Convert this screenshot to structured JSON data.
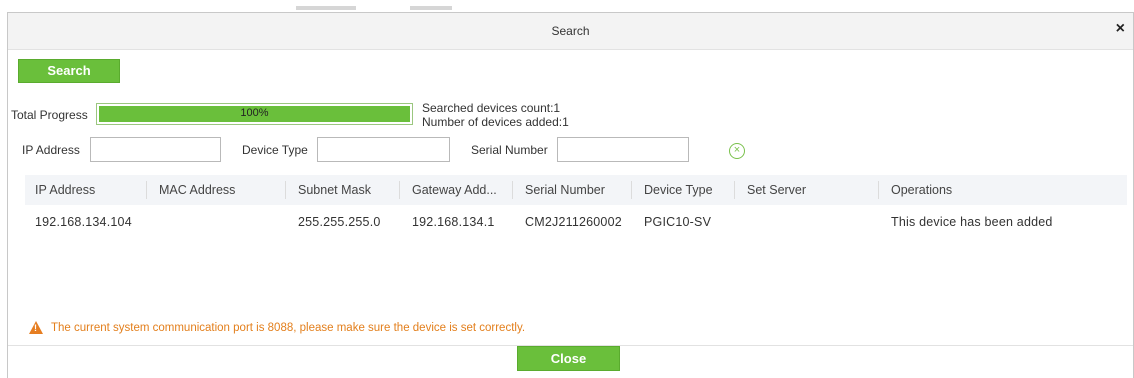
{
  "dialog": {
    "title": "Search",
    "close_glyph": "×"
  },
  "toolbar": {
    "search_label": "Search"
  },
  "progress": {
    "label": "Total Progress",
    "percent": 100,
    "percent_text": "100%",
    "searched_count_text": "Searched devices count:1",
    "added_count_text": "Number of devices added:1"
  },
  "filters": {
    "ip_label": "IP Address",
    "ip_value": "",
    "device_type_label": "Device Type",
    "device_type_value": "",
    "serial_label": "Serial Number",
    "serial_value": "",
    "clear_icon": "clear-circle-icon"
  },
  "table": {
    "columns": [
      "IP Address",
      "MAC Address",
      "Subnet Mask",
      "Gateway Add...",
      "Serial Number",
      "Device Type",
      "Set Server",
      "Operations"
    ],
    "rows": [
      {
        "ip": "192.168.134.104",
        "mac": "",
        "subnet": "255.255.255.0",
        "gateway": "192.168.134.1",
        "serial": "CM2J211260002",
        "device_type": "PGIC10-SV",
        "set_server": "",
        "operations": "This device has been added"
      }
    ]
  },
  "warning": {
    "icon": "warning-triangle-icon",
    "text": "The current system communication port is 8088, please make sure the device is set correctly."
  },
  "footer": {
    "close_label": "Close"
  },
  "colors": {
    "accent_green": "#6abf3b",
    "warning_orange": "#e37f1c"
  }
}
